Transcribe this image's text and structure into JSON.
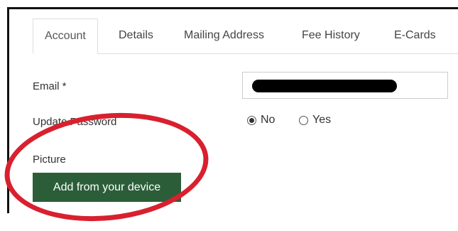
{
  "tabs": [
    {
      "label": "Account",
      "active": true
    },
    {
      "label": "Details",
      "active": false
    },
    {
      "label": "Mailing Address",
      "active": false
    },
    {
      "label": "Fee History",
      "active": false
    },
    {
      "label": "E-Cards",
      "active": false
    }
  ],
  "form": {
    "email_label": "Email *",
    "email_value": "",
    "password_label": "Update Password",
    "radio_no": "No",
    "radio_yes": "Yes",
    "radio_selected": "No",
    "picture_label": "Picture",
    "add_button": "Add from your device"
  },
  "annotation": {
    "color": "#d9202e"
  },
  "colors": {
    "button_bg": "#2b5e38"
  }
}
